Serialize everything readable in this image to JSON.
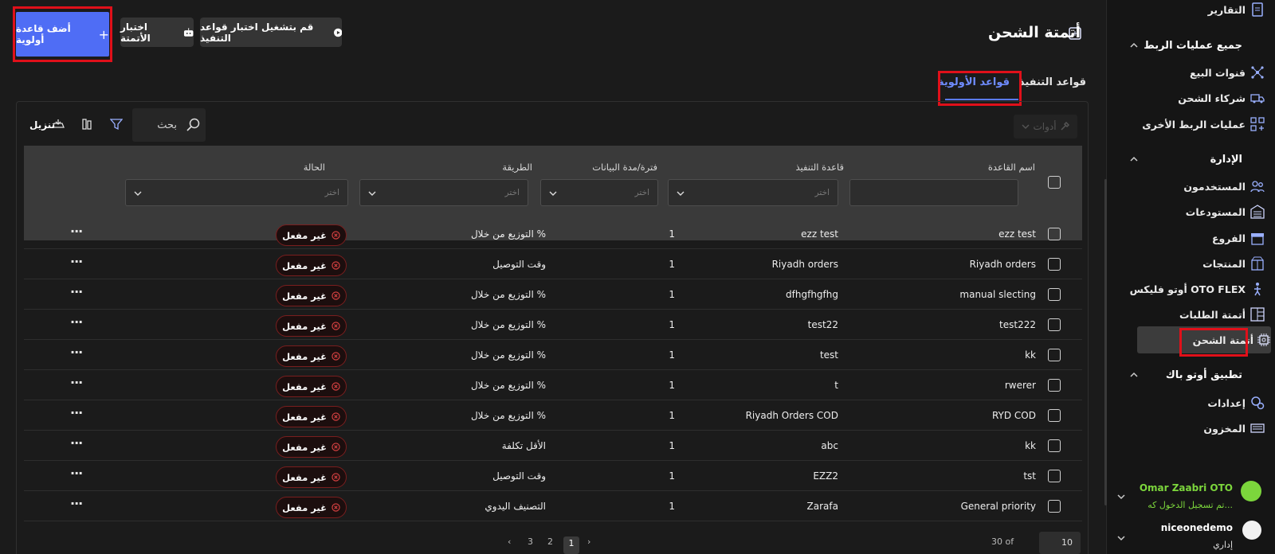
{
  "header": {
    "title": "أتمتة الشحن",
    "add_button": "أضف قاعدة أولوية",
    "test_automation_button": "اختبار الأتمتة",
    "run_test_button": "قم بتشغيل اختبار قواعد التنفيذ"
  },
  "tabs": [
    {
      "label": "قواعد التنفيذ",
      "active": false
    },
    {
      "label": "قواعد الأولوية",
      "active": true
    }
  ],
  "toolbar": {
    "tools_label": "أدوات",
    "search_label": "بحث",
    "download_label": "تنزيل"
  },
  "table": {
    "columns": [
      "اسم القاعدة",
      "قاعدة التنفيذ",
      "فترة/مدة البيانات",
      "الطريقة",
      "الحالة"
    ],
    "filter_placeholder": "اختر",
    "rows": [
      {
        "name": "ezz test",
        "rule": "ezz test",
        "period": "1",
        "method": "التوزيع من خلال %",
        "status": "غير مفعل"
      },
      {
        "name": "Riyadh orders",
        "rule": "Riyadh orders",
        "period": "1",
        "method": "وقت التوصيل",
        "status": "غير مفعل"
      },
      {
        "name": "manual slecting",
        "rule": "dfhgfhgfhg",
        "period": "1",
        "method": "التوزيع من خلال %",
        "status": "غير مفعل"
      },
      {
        "name": "test222",
        "rule": "test22",
        "period": "1",
        "method": "التوزيع من خلال %",
        "status": "غير مفعل"
      },
      {
        "name": "kk",
        "rule": "test",
        "period": "1",
        "method": "التوزيع من خلال %",
        "status": "غير مفعل"
      },
      {
        "name": "rwerer",
        "rule": "t",
        "period": "1",
        "method": "التوزيع من خلال %",
        "status": "غير مفعل"
      },
      {
        "name": "RYD COD",
        "rule": "Riyadh Orders COD",
        "period": "1",
        "method": "التوزيع من خلال %",
        "status": "غير مفعل"
      },
      {
        "name": "kk",
        "rule": "abc",
        "period": "1",
        "method": "الأقل تكلفة",
        "status": "غير مفعل"
      },
      {
        "name": "tst",
        "rule": "EZZ2",
        "period": "1",
        "method": "وقت التوصيل",
        "status": "غير مفعل"
      },
      {
        "name": "General priority",
        "rule": "Zarafa",
        "period": "1",
        "method": "التصنيف اليدوي",
        "status": "غير مفعل"
      }
    ],
    "more_glyph": "···"
  },
  "pagination": {
    "pages": [
      "1",
      "2",
      "3"
    ],
    "current": "1",
    "total_text": "30 of",
    "page_size": "10"
  },
  "sidebar": {
    "reports": "التقارير",
    "integrations_section": "جميع عمليات الربط",
    "sales_channels": "قنوات البيع",
    "shipping_partners": "شركاء الشحن",
    "other_integrations": "عمليات الربط الأخرى",
    "admin_section": "الإدارة",
    "users": "المستخدمون",
    "warehouses": "المستودعات",
    "branches": "الفروع",
    "products": "المنتجات",
    "oto_flex": "أوتو فليكس OTO FLEX",
    "order_automation": "أتمتة الطلبات",
    "shipping_automation": "أتمتة الشحن",
    "otopack_section": "تطبيق أوتو باك",
    "settings": "إعدادات",
    "inventory": "المخزون",
    "support_name": "Omar Zaabri OTO",
    "support_status": "تم تسجيل الدخول كه...",
    "account_name": "niceonedemo",
    "account_role": "إداري"
  },
  "colors": {
    "accent": "#4f6df5",
    "highlight": "#e0101a",
    "status_border": "#7a1e1e",
    "support_green": "#7cd63c"
  }
}
